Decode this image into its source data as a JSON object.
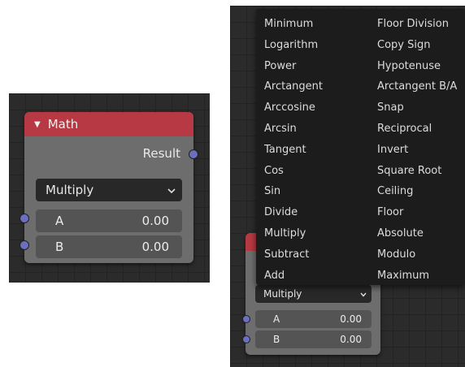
{
  "left_node": {
    "title": "Math",
    "output_label": "Result",
    "operation": "Multiply",
    "inputs": [
      {
        "label": "A",
        "value": "0.00"
      },
      {
        "label": "B",
        "value": "0.00"
      }
    ]
  },
  "right_node": {
    "operation": "Multiply",
    "inputs": [
      {
        "label": "A",
        "value": "0.00"
      },
      {
        "label": "B",
        "value": "0.00"
      }
    ]
  },
  "menu": {
    "left_column": [
      "Minimum",
      "Logarithm",
      "Power",
      "Arctangent",
      "Arccosine",
      "Arcsin",
      "Tangent",
      "Cos",
      "Sin",
      "Divide",
      "Multiply",
      "Subtract",
      "Add"
    ],
    "right_column": [
      "Floor Division",
      "Copy Sign",
      "Hypotenuse",
      "Arctangent B/A",
      "Snap",
      "Reciprocal",
      "Invert",
      "Square Root",
      "Ceiling",
      "Floor",
      "Absolute",
      "Modulo",
      "Maximum"
    ]
  },
  "colors": {
    "node_header": "#b63943",
    "node_body": "#6d6d6d",
    "socket": "#6a6fc0",
    "menu_bg": "#1c1c1c",
    "editor_bg": "#2b2b2b"
  },
  "icons": {
    "collapse": "triangle-down-icon",
    "dropdown": "chevron-down-icon"
  }
}
